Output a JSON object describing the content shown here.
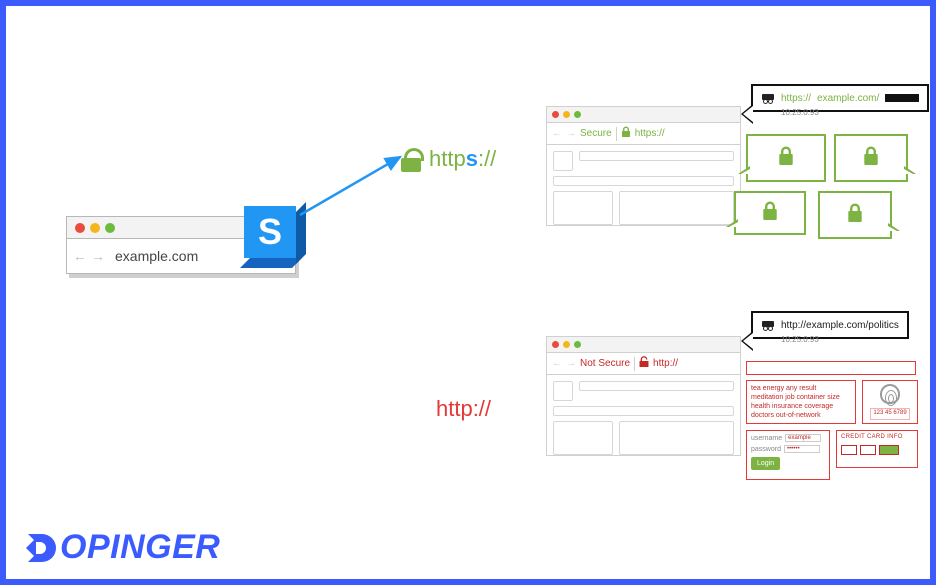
{
  "diagram": {
    "source": {
      "url": "example.com"
    },
    "https": {
      "label_prefix": "http",
      "label_s": "s",
      "label_suffix": "://",
      "browser": {
        "status": "Secure",
        "protocol": "https://"
      },
      "tooltip": {
        "url_prefix": "https://",
        "url_host": "example.com/",
        "ip": "10.25.0.93"
      }
    },
    "http": {
      "label": "http://",
      "browser": {
        "status": "Not Secure",
        "protocol": "http://"
      },
      "tooltip": {
        "url": "http://example.com/politics",
        "ip": "10.25.0.93"
      },
      "leaked": {
        "search_terms": [
          "tea energy any result",
          "meditation job container size",
          "health insurance coverage",
          "doctors out-of-network"
        ],
        "cc_label": "CREDIT CARD INFO",
        "cc_number": "123 45 6789",
        "login": {
          "user_label": "username",
          "user_value": "example",
          "pass_label": "password",
          "pass_value": "••••••",
          "button": "Login"
        }
      }
    }
  },
  "brand": {
    "name": "OPINGER"
  }
}
